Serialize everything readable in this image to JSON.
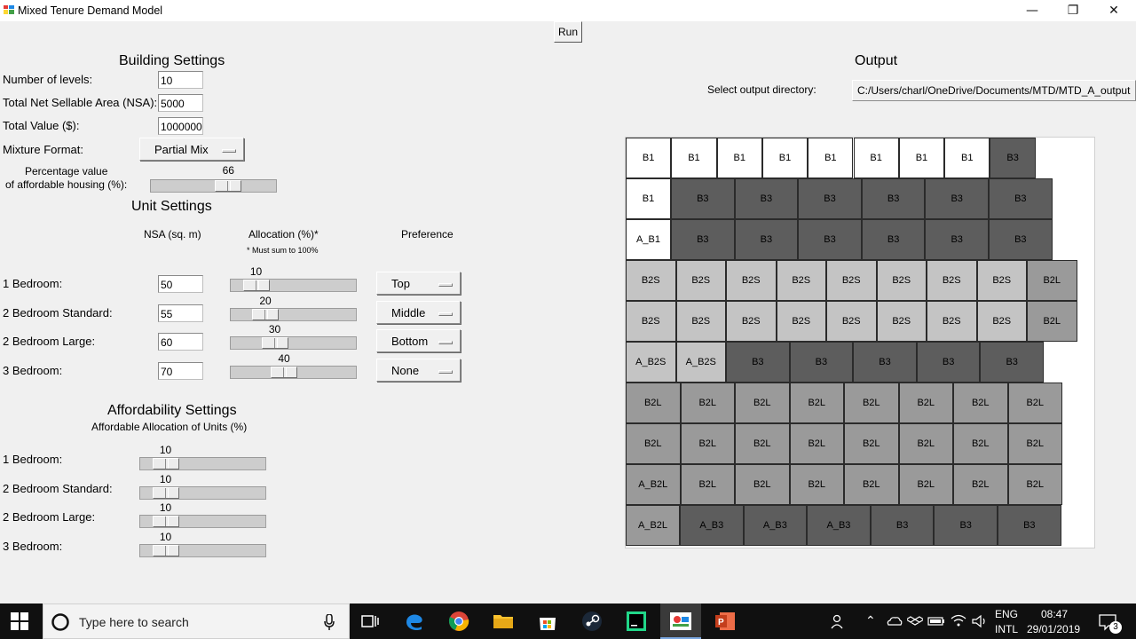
{
  "window": {
    "title": "Mixed Tenure Demand Model",
    "minimize": "—",
    "restore": "❐",
    "close": "✕"
  },
  "run_label": "Run",
  "building": {
    "header": "Building Settings",
    "levels_label": "Number of levels:",
    "levels_value": "10",
    "nsa_label": "Total Net Sellable Area (NSA):",
    "nsa_value": "5000",
    "value_label": "Total Value ($):",
    "value_value": "1000000",
    "mixture_label": "Mixture Format:",
    "mixture_value": "Partial Mix",
    "pct_label_1": "Percentage value",
    "pct_label_2": "of affordable housing (%):",
    "pct_value": "66",
    "pct_num": 66
  },
  "unit": {
    "header": "Unit Settings",
    "col_nsa": "NSA (sq. m)",
    "col_alloc": "Allocation (%)*",
    "col_alloc_note": "* Must sum to 100%",
    "col_pref": "Preference",
    "rows": [
      {
        "label": "1 Bedroom:",
        "nsa": "50",
        "alloc": "10",
        "alloc_num": 10,
        "pref": "Top"
      },
      {
        "label": "2 Bedroom Standard:",
        "nsa": "55",
        "alloc": "20",
        "alloc_num": 20,
        "pref": "Middle"
      },
      {
        "label": "2 Bedroom Large:",
        "nsa": "60",
        "alloc": "30",
        "alloc_num": 30,
        "pref": "Bottom"
      },
      {
        "label": "3 Bedroom:",
        "nsa": "70",
        "alloc": "40",
        "alloc_num": 40,
        "pref": "None"
      }
    ]
  },
  "afford": {
    "header": "Affordability Settings",
    "subheader": "Affordable Allocation of Units (%)",
    "rows": [
      {
        "label": "1 Bedroom:",
        "value": "10",
        "num": 10
      },
      {
        "label": "2 Bedroom Standard:",
        "value": "10",
        "num": 10
      },
      {
        "label": "2 Bedroom Large:",
        "value": "10",
        "num": 10
      },
      {
        "label": "3 Bedroom:",
        "value": "10",
        "num": 10
      }
    ]
  },
  "output": {
    "header": "Output",
    "dir_label": "Select output directory:",
    "dir_value": "C:/Users/charl/OneDrive/Documents/MTD/MTD_A_output",
    "grid": [
      [
        "B1",
        "B1",
        "B1",
        "B1",
        "B1",
        "B1",
        "B1",
        "B1",
        "B3"
      ],
      [
        "B1",
        "B3",
        "B3",
        "B3",
        "B3",
        "B3",
        "B3"
      ],
      [
        "A_B1",
        "B3",
        "B3",
        "B3",
        "B3",
        "B3",
        "B3"
      ],
      [
        "B2S",
        "B2S",
        "B2S",
        "B2S",
        "B2S",
        "B2S",
        "B2S",
        "B2S",
        "B2L"
      ],
      [
        "B2S",
        "B2S",
        "B2S",
        "B2S",
        "B2S",
        "B2S",
        "B2S",
        "B2S",
        "B2L"
      ],
      [
        "A_B2S",
        "A_B2S",
        "B3",
        "B3",
        "B3",
        "B3",
        "B3"
      ],
      [
        "B2L",
        "B2L",
        "B2L",
        "B2L",
        "B2L",
        "B2L",
        "B2L",
        "B2L"
      ],
      [
        "B2L",
        "B2L",
        "B2L",
        "B2L",
        "B2L",
        "B2L",
        "B2L",
        "B2L"
      ],
      [
        "A_B2L",
        "B2L",
        "B2L",
        "B2L",
        "B2L",
        "B2L",
        "B2L",
        "B2L"
      ],
      [
        "A_B2L",
        "A_B3",
        "A_B3",
        "A_B3",
        "B3",
        "B3",
        "B3"
      ]
    ]
  },
  "taskbar": {
    "search_placeholder": "Type here to search",
    "lang_1": "ENG",
    "lang_2": "INTL",
    "time": "08:47",
    "date": "29/01/2019",
    "notif_count": "3"
  }
}
